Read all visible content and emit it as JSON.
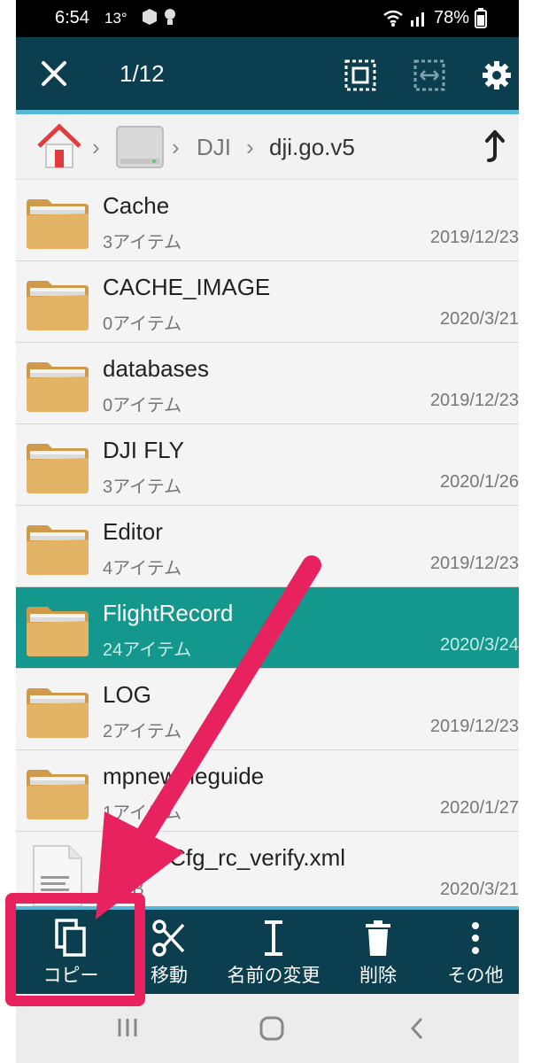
{
  "status_bar": {
    "time": "6:54",
    "temp": "13°",
    "battery": "78%"
  },
  "toolbar": {
    "selection_count": "1/12"
  },
  "breadcrumb": {
    "folder": "DJI",
    "current": "dji.go.v5"
  },
  "files": [
    {
      "name": "Cache",
      "items": "3アイテム",
      "date": "2019/12/23",
      "type": "folder"
    },
    {
      "name": "CACHE_IMAGE",
      "items": "0アイテム",
      "date": "2020/3/21",
      "type": "folder"
    },
    {
      "name": "databases",
      "items": "0アイテム",
      "date": "2019/12/23",
      "type": "folder"
    },
    {
      "name": "DJI FLY",
      "items": "3アイテム",
      "date": "2020/1/26",
      "type": "folder"
    },
    {
      "name": "Editor",
      "items": "4アイテム",
      "date": "2019/12/23",
      "type": "folder"
    },
    {
      "name": "FlightRecord",
      "items": "24アイテム",
      "date": "2020/3/24",
      "type": "folder",
      "selected": true
    },
    {
      "name": "LOG",
      "items": "2アイテム",
      "date": "2019/12/23",
      "type": "folder"
    },
    {
      "name": "mpnewbieguide",
      "items": "1アイテム",
      "date": "2020/1/27",
      "type": "folder"
    },
    {
      "name": "deviceCfg_rc_verify.xml",
      "items": "7.3 B",
      "date": "2020/3/21",
      "type": "file"
    }
  ],
  "actions": {
    "copy": "コピー",
    "move": "移動",
    "rename": "名前の変更",
    "delete": "削除",
    "more": "その他"
  },
  "colors": {
    "toolbar_bg": "#0b3e4e",
    "selection": "#14978c",
    "accent": "#56b8d6",
    "annotation": "#e8215f"
  }
}
